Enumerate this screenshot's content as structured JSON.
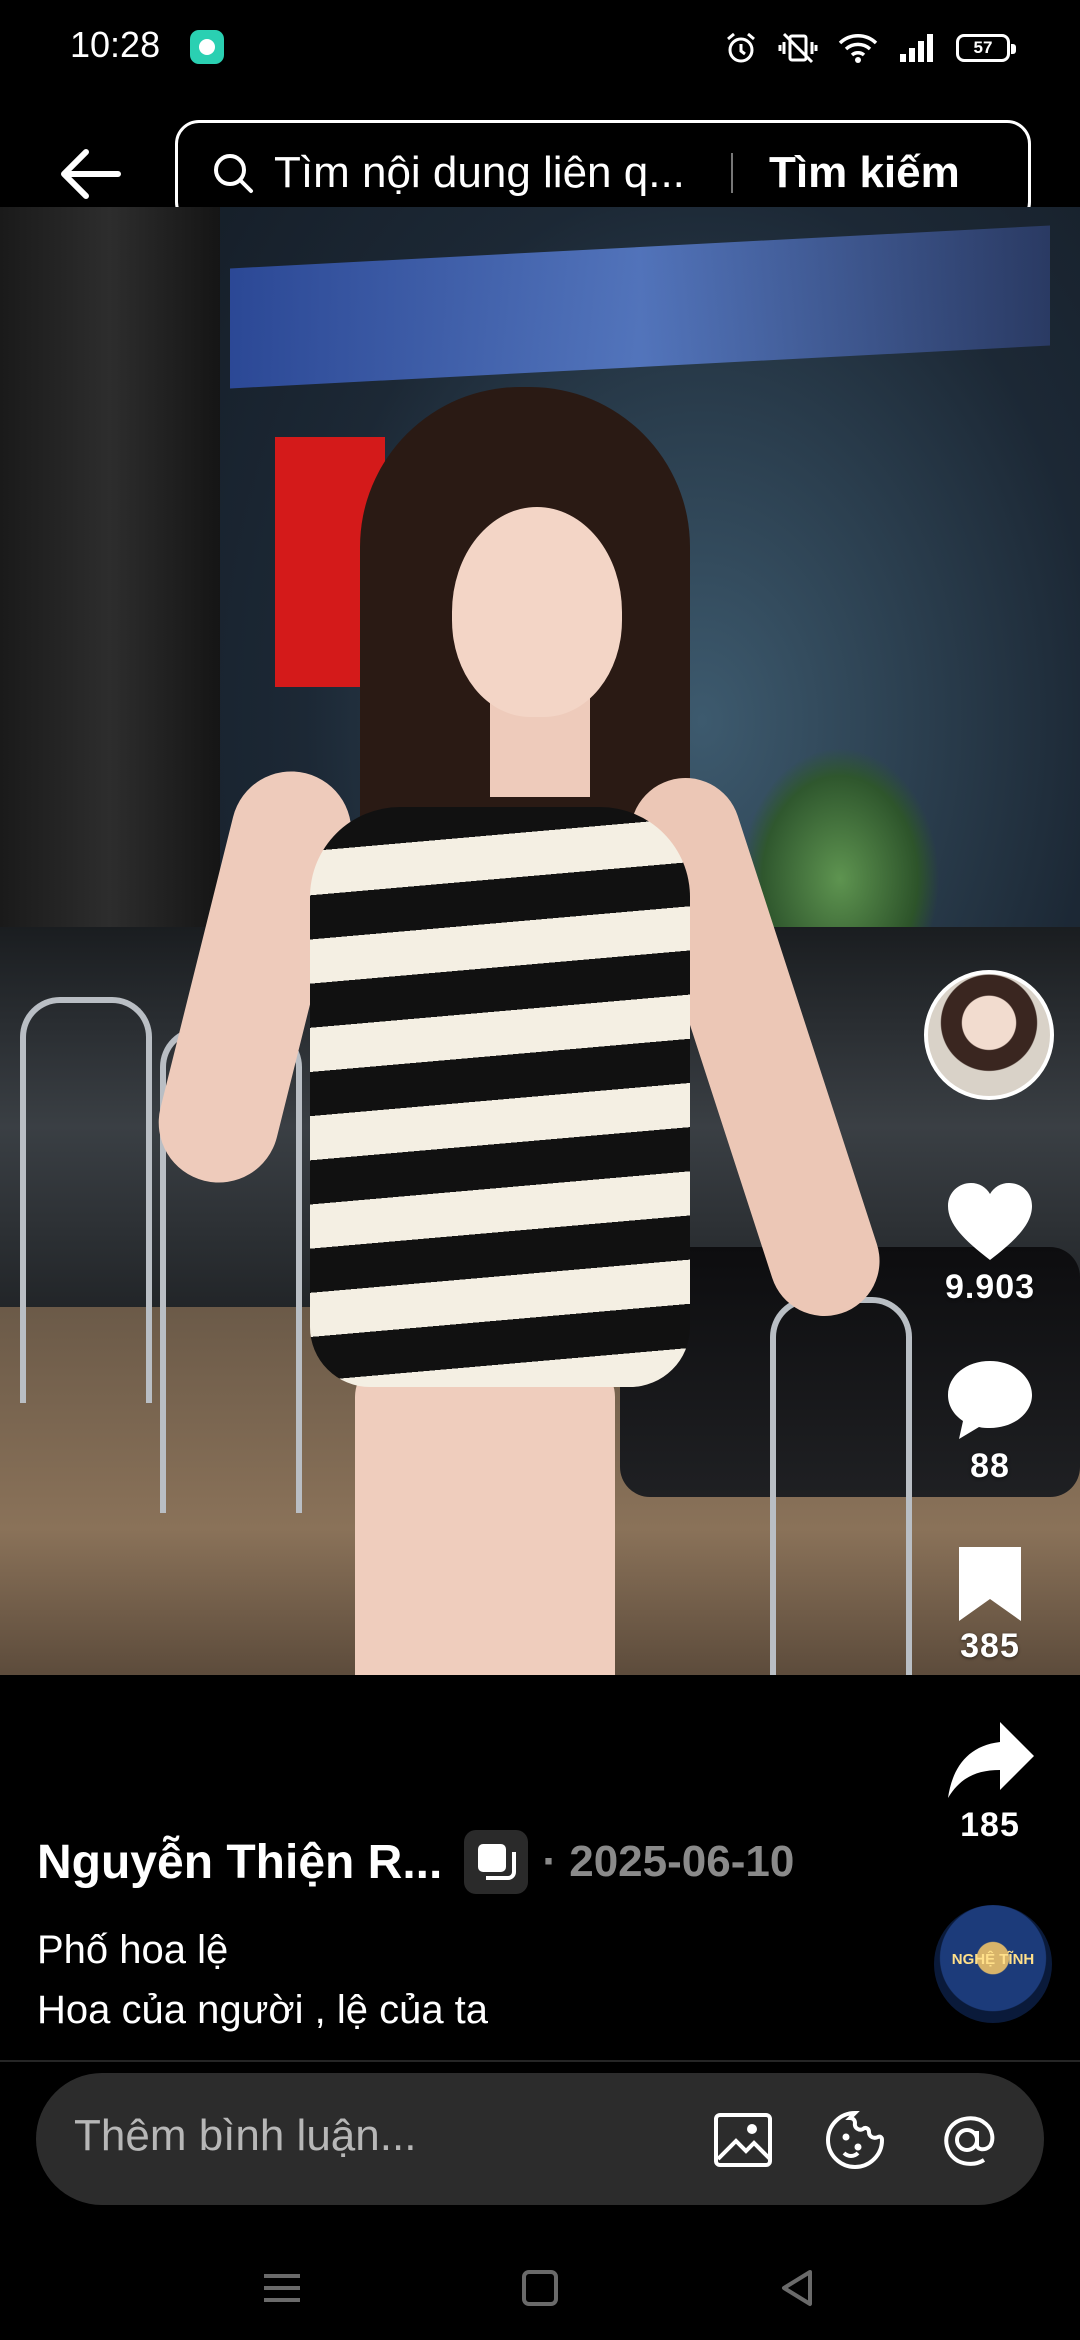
{
  "status_bar": {
    "time": "10:28",
    "battery": "57",
    "icons": [
      "chat-app-icon",
      "alarm-icon",
      "vibrate-icon",
      "wifi-icon",
      "signal-icon",
      "battery-icon"
    ]
  },
  "header": {
    "search_placeholder": "Tìm nội dung liên q...",
    "search_button": "Tìm kiếm"
  },
  "actions": {
    "likes": "9.903",
    "comments": "88",
    "saves": "385",
    "shares": "185"
  },
  "post": {
    "author": "Nguyễn Thiện R...",
    "date": "· 2025-06-10",
    "caption_line1": "Phố hoa lệ",
    "caption_line2": "Hoa của người , lệ của ta",
    "music_disc_text": "NGHỆ TĨNH"
  },
  "comment_bar": {
    "placeholder": "Thêm bình luận..."
  },
  "colors": {
    "background": "#000000",
    "date_gray": "#8a8a8a",
    "comment_bar_bg": "#2c2c2c"
  }
}
